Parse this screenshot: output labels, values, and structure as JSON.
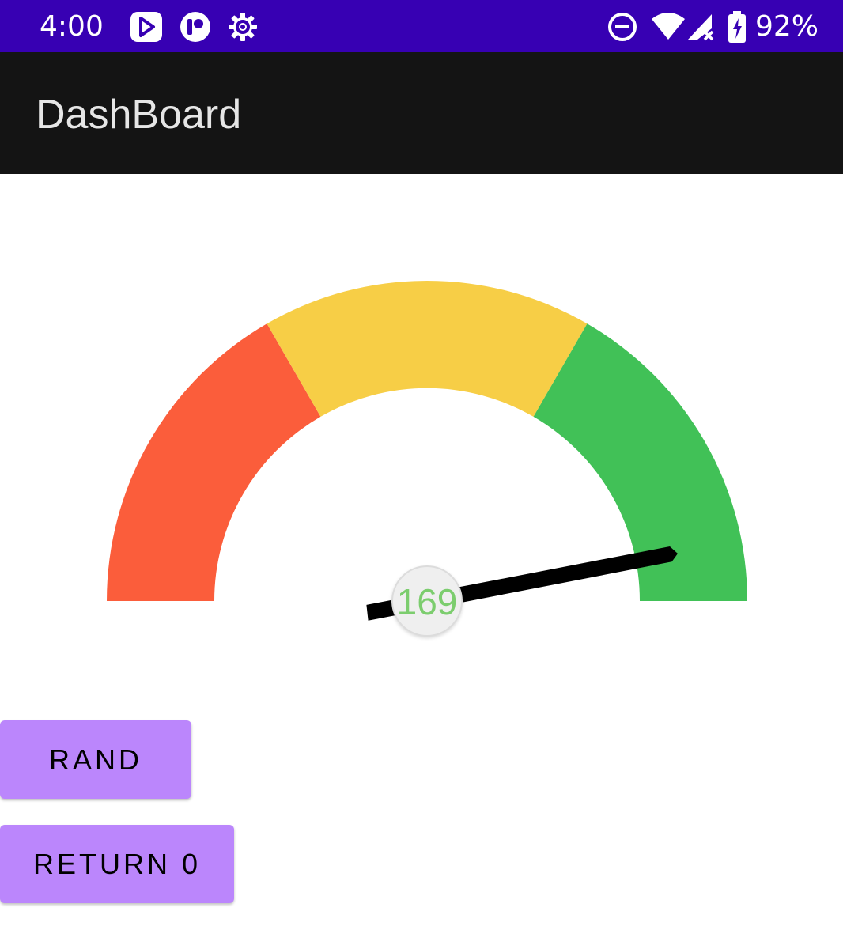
{
  "status_bar": {
    "time": "4:00",
    "battery_text": "92%",
    "background": "#3700b3",
    "left_icons": [
      "play-store-icon",
      "app-r-icon",
      "settings-gear-icon"
    ],
    "right_icons": [
      "do-not-disturb-icon",
      "wifi-icon",
      "cellular-no-signal-icon",
      "battery-charging-icon"
    ]
  },
  "app_bar": {
    "title": "DashBoard",
    "background": "#141414"
  },
  "gauge": {
    "value": "169",
    "value_numeric": 169,
    "needle_angle_deg": 11,
    "segments": [
      {
        "name": "low",
        "color": "#fb5d3b"
      },
      {
        "name": "mid",
        "color": "#f7ce46"
      },
      {
        "name": "high",
        "color": "#41c157"
      }
    ],
    "value_color": "#7ccd6e"
  },
  "buttons": {
    "rand_label": "RAND",
    "return_label": "RETURN 0",
    "color": "#bb86fc"
  }
}
